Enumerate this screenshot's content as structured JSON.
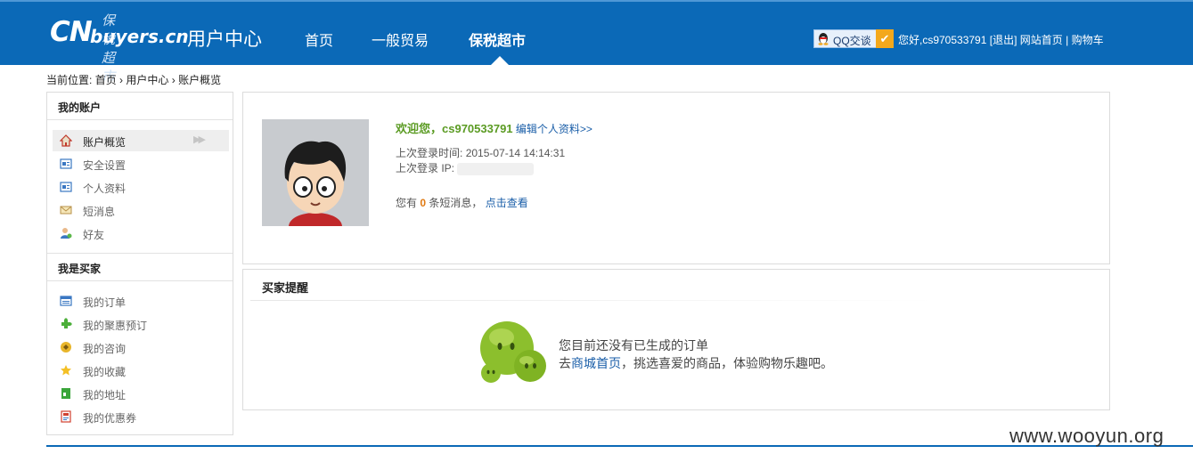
{
  "header": {
    "logo": {
      "cn": "CN",
      "buyers": "buyers.cn",
      "sub": "保税超市",
      "title": "用户中心"
    },
    "nav": [
      {
        "label": "首页"
      },
      {
        "label": "一般贸易"
      },
      {
        "label": "保税超市",
        "active": true
      }
    ],
    "qq_label": "QQ交谈",
    "greeting": "您好,cs970533791",
    "logout": "[退出]",
    "site_home": "网站首页",
    "separator": "|",
    "cart": "购物车"
  },
  "breadcrumb": {
    "prefix": "当前位置:",
    "items": [
      "首页",
      "用户中心",
      "账户概览"
    ],
    "sep": "›"
  },
  "sidebar": {
    "section1_title": "我的账户",
    "account_items": [
      {
        "label": "账户概览",
        "icon": "home-icon",
        "selected": true
      },
      {
        "label": "安全设置",
        "icon": "security-icon"
      },
      {
        "label": "个人资料",
        "icon": "profile-icon"
      },
      {
        "label": "短消息",
        "icon": "envelope-icon"
      },
      {
        "label": "好友",
        "icon": "friend-icon"
      }
    ],
    "section2_title": "我是买家",
    "buyer_items": [
      {
        "label": "我的订单",
        "icon": "order-icon"
      },
      {
        "label": "我的聚惠预订",
        "icon": "puzzle-icon"
      },
      {
        "label": "我的咨询",
        "icon": "consult-icon"
      },
      {
        "label": "我的收藏",
        "icon": "star-icon"
      },
      {
        "label": "我的地址",
        "icon": "address-icon"
      },
      {
        "label": "我的优惠券",
        "icon": "coupon-icon"
      }
    ]
  },
  "overview": {
    "welcome": "欢迎您，cs970533791",
    "edit_link": "编辑个人资料>>",
    "last_login_time_label": "上次登录时间:",
    "last_login_time": "2015-07-14 14:14:31",
    "last_login_ip_label": "上次登录 IP:",
    "msg_prefix": "您有",
    "msg_count": "0",
    "msg_suffix": "条短消息，",
    "msg_link": "点击查看"
  },
  "reminder": {
    "title": "买家提醒",
    "empty_line1": "您目前还没有已生成的订单",
    "empty_line2_prefix": "去",
    "empty_link": "商城首页",
    "empty_line2_suffix": "，挑选喜爱的商品，体验购物乐趣吧。"
  },
  "watermark": "www.wooyun.org",
  "colors": {
    "header_bg": "#0b69b7",
    "welcome_green": "#5b9b23",
    "link_blue": "#1a5ea8",
    "count_orange": "#e07a12"
  }
}
